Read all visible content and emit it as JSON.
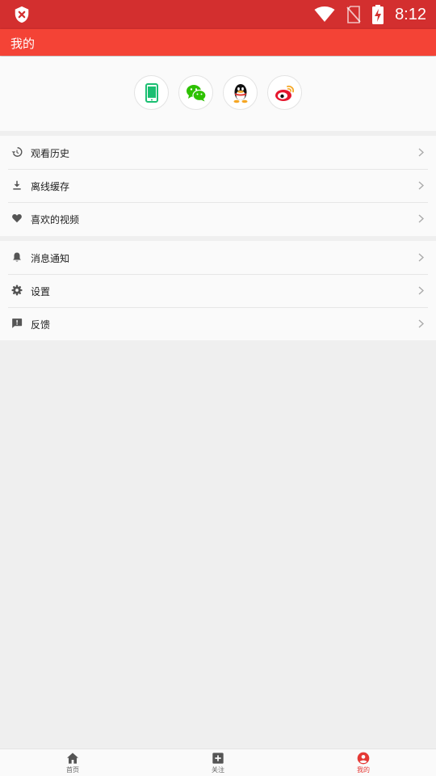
{
  "status_bar": {
    "time": "8:12",
    "icons": [
      "security-shield-icon",
      "wifi-icon",
      "no-sim-icon",
      "battery-charging-icon"
    ],
    "color": "#d32f2f"
  },
  "app_bar": {
    "title": "我的",
    "color": "#f44336"
  },
  "login_options": [
    {
      "name": "phone-login",
      "icon": "phone-icon"
    },
    {
      "name": "wechat-login",
      "icon": "wechat-icon"
    },
    {
      "name": "qq-login",
      "icon": "qq-icon"
    },
    {
      "name": "weibo-login",
      "icon": "weibo-icon"
    }
  ],
  "menu": {
    "group1": [
      {
        "label": "观看历史",
        "icon": "history-icon"
      },
      {
        "label": "离线缓存",
        "icon": "download-icon"
      },
      {
        "label": "喜欢的视频",
        "icon": "heart-icon"
      }
    ],
    "group2": [
      {
        "label": "消息通知",
        "icon": "bell-icon"
      },
      {
        "label": "设置",
        "icon": "gear-icon"
      },
      {
        "label": "反馈",
        "icon": "feedback-icon"
      }
    ]
  },
  "bottom_nav": [
    {
      "label": "首页",
      "icon": "home-icon",
      "active": false
    },
    {
      "label": "关注",
      "icon": "add-box-icon",
      "active": false
    },
    {
      "label": "我的",
      "icon": "account-icon",
      "active": true
    }
  ],
  "colors": {
    "accent": "#f44336",
    "active_tab": "#e53935",
    "phone_green": "#1bbf72",
    "wechat_green": "#2dc100",
    "weibo_red": "#e6162d"
  }
}
